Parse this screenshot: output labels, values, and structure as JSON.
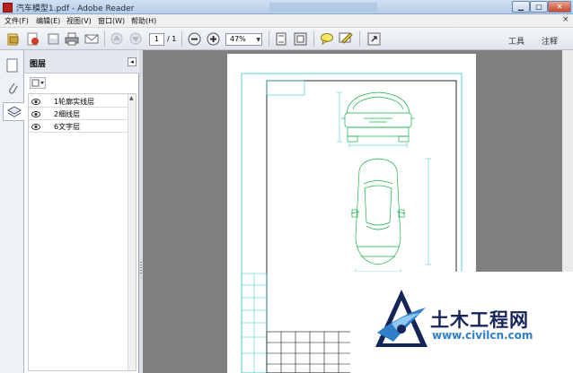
{
  "window": {
    "title": "汽车模型1.pdf - Adobe Reader",
    "controls": {
      "minimize": "▁",
      "maximize": "□",
      "close": "✕"
    }
  },
  "menu": {
    "items": [
      "文件(F)",
      "编辑(E)",
      "视图(V)",
      "窗口(W)",
      "帮助(H)"
    ],
    "close_x": "×"
  },
  "toolbar": {
    "page_current": "1",
    "page_total": "/ 1",
    "zoom": "47%",
    "tools_label": "工具",
    "comment_label": "注释",
    "icons": [
      "create-pdf-icon",
      "share-icon",
      "save-icon",
      "print-icon",
      "email-icon",
      "prev-page-icon",
      "next-page-icon",
      "zoom-out-icon",
      "zoom-in-icon",
      "fit-page-icon",
      "fullscreen-icon",
      "comment-icon",
      "highlight-icon",
      "expand-icon"
    ]
  },
  "layers": {
    "title": "图层",
    "collapse": "◂",
    "items": [
      {
        "label": "1轮廓实线层",
        "visible": true
      },
      {
        "label": "2细线层",
        "visible": true
      },
      {
        "label": "6文字层",
        "visible": true
      }
    ]
  },
  "watermark": {
    "name": "土木工程网",
    "url": "www.civilcn.com"
  },
  "colors": {
    "drawing_green": "#16b04a",
    "drawing_cyan": "#2ec9c0",
    "reader_red": "#b7201b",
    "watermark_navy": "#16245a",
    "watermark_blue": "#2f7fc8"
  }
}
